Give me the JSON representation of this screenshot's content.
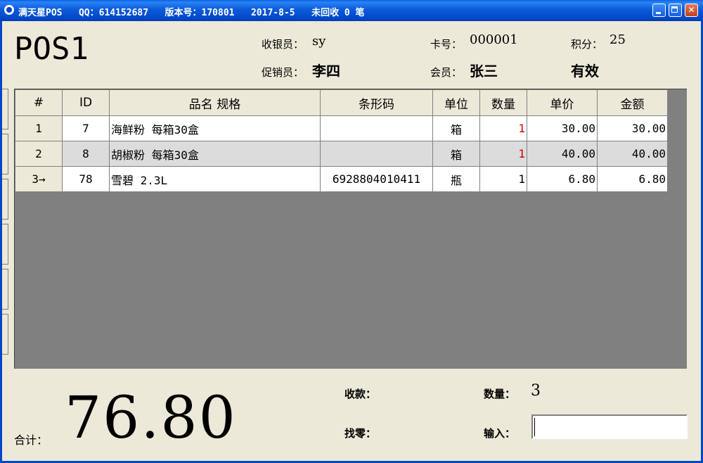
{
  "window": {
    "title": "满天星POS   QQ：614152687   版本号：170801   2017-8-5   未回收 0 笔"
  },
  "header": {
    "pos_name": "POS1",
    "cashier_label": "收银员：",
    "cashier_value": "sy",
    "promoter_label": "促销员：",
    "promoter_value": "李四",
    "card_label": "卡号：",
    "card_value": "000001",
    "member_label": "会员：",
    "member_value": "张三",
    "points_label": "积分：",
    "points_value": "25",
    "status_value": "有效"
  },
  "table": {
    "columns": [
      "#",
      "ID",
      "品名 规格",
      "条形码",
      "单位",
      "数量",
      "单价",
      "金额"
    ],
    "rows": [
      {
        "no": "1",
        "id": "7",
        "name": "海鲜粉 每箱30盒",
        "barcode": "",
        "unit": "箱",
        "qty": "1",
        "price": "30.00",
        "amount": "30.00"
      },
      {
        "no": "2",
        "id": "8",
        "name": "胡椒粉 每箱30盒",
        "barcode": "",
        "unit": "箱",
        "qty": "1",
        "price": "40.00",
        "amount": "40.00"
      },
      {
        "no": "3→",
        "id": "78",
        "name": "雪碧 2.3L",
        "barcode": "6928804010411",
        "unit": "瓶",
        "qty": "1",
        "price": "6.80",
        "amount": "6.80"
      }
    ]
  },
  "footer": {
    "total_label": "合计：",
    "total_value": "76.80",
    "received_label": "收款：",
    "change_label": "找零：",
    "quantity_label": "数量：",
    "quantity_value": "3",
    "input_label": "输入：",
    "input_value": ""
  },
  "colors": {
    "titlebar": "#0046c8",
    "window_bg": "#ece9d8",
    "grid_bg": "#808080",
    "alt_row": "#dcdcdc",
    "qty_red": "#d00000"
  }
}
